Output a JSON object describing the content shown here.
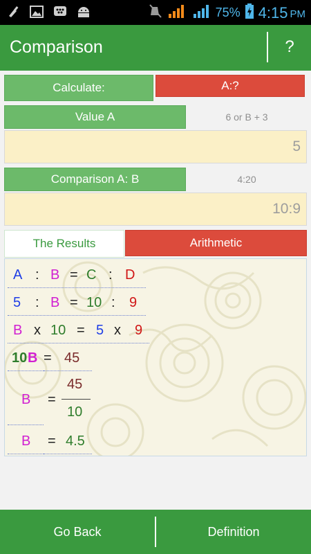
{
  "status_bar": {
    "battery_percent": "75%",
    "time": "4:15",
    "ampm": "PM",
    "left_icons": [
      "broom-icon",
      "image-icon",
      "bbm-icon",
      "android-icon"
    ],
    "right_icons": [
      "mute-icon",
      "signal-icon",
      "battery-icon"
    ]
  },
  "action_bar": {
    "title": "Comparison",
    "help_label": "?"
  },
  "calculate": {
    "label": "Calculate:",
    "value": "A:?"
  },
  "value_a": {
    "label": "Value A",
    "hint": "6 or B + 3",
    "input_value": "5"
  },
  "comparison": {
    "label": "Comparison A: B",
    "hint": "4:20",
    "input_value": "10:9"
  },
  "tabs": {
    "results": "The Results",
    "arithmetic": "Arithmetic"
  },
  "results": {
    "line1": [
      "A",
      ":",
      "B",
      "=",
      "C",
      ":",
      "D"
    ],
    "line2": [
      "5",
      ":",
      "B",
      "=",
      "10",
      ":",
      "9"
    ],
    "line3": [
      "B",
      "x",
      "10",
      "=",
      "5",
      "x",
      "9"
    ],
    "line4": [
      "10",
      "B",
      "=",
      "45"
    ],
    "line5": {
      "var": "B",
      "eq": "=",
      "numerator": "45",
      "denominator": "10"
    },
    "line6": [
      "B",
      "=",
      "4.5"
    ]
  },
  "bottom_bar": {
    "back": "Go Back",
    "definition": "Definition"
  },
  "colors": {
    "green": "#3a9a3f",
    "light_green": "#6cba6a",
    "red": "#dc4b3c",
    "input_bg": "#fbf0c7",
    "status_blue": "#4fb6ea"
  }
}
